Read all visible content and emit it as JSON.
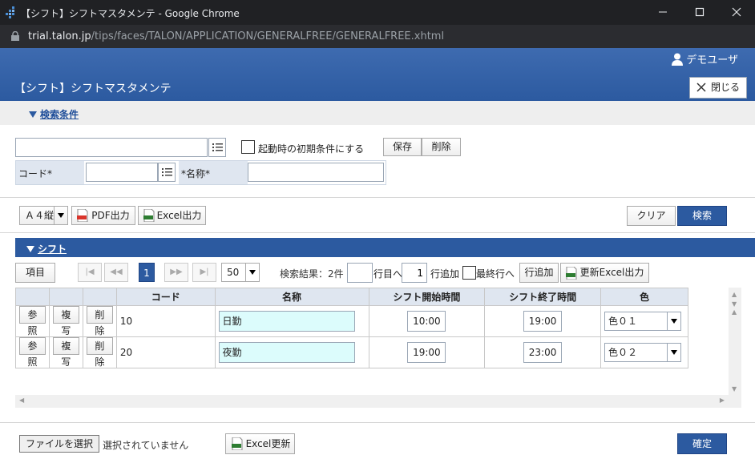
{
  "window": {
    "title": "【シフト】シフトマスタメンテ - Google Chrome"
  },
  "browser": {
    "url_host": "trial.talon.jp",
    "url_path": "/tips/faces/TALON/APPLICATION/GENERALFREE/GENERALFREE.xhtml"
  },
  "header": {
    "user": "デモユーザ",
    "page_title": "【シフト】シフトマスタメンテ",
    "close_label": "閉じる"
  },
  "search": {
    "section_label": "検索条件",
    "startup_label": "起動時の初期条件にする",
    "save_label": "保存",
    "delete_label": "削除",
    "code_label": "コード*",
    "name_label": "*名称*"
  },
  "toolbar": {
    "paper_size": "Ａ４縦",
    "pdf_label": "PDF出力",
    "excel_label": "Excel出力",
    "clear_label": "クリア",
    "search_label": "検索"
  },
  "shift": {
    "section_label": "シフト",
    "items_label": "項目",
    "current_page": "1",
    "page_size": "50",
    "result_text": "検索結果：2件",
    "goto_row_label": "行目へ",
    "add_count": "1",
    "add_row_label": "行追加",
    "last_row_label": "最終行へ",
    "add_row_button": "行追加",
    "excel_update_output": "更新Excel出力"
  },
  "table": {
    "headers": [
      "",
      "",
      "",
      "コード",
      "名称",
      "シフト開始時間",
      "シフト終了時間",
      "色"
    ],
    "ref_label": "参照",
    "copy_label": "複写",
    "del_label": "削除",
    "rows": [
      {
        "code": "10",
        "name": "日勤",
        "start": "10:00",
        "end": "19:00",
        "color": "色０１"
      },
      {
        "code": "20",
        "name": "夜勤",
        "start": "19:00",
        "end": "23:00",
        "color": "色０２"
      }
    ]
  },
  "footer": {
    "file_button": "ファイルを選択",
    "file_status": "選択されていません",
    "excel_update": "Excel更新",
    "confirm": "確定"
  },
  "colors": {
    "accent": "#2c5aa0",
    "header_cell": "#dfe6f0",
    "name_cell": "#dcfcfc"
  }
}
